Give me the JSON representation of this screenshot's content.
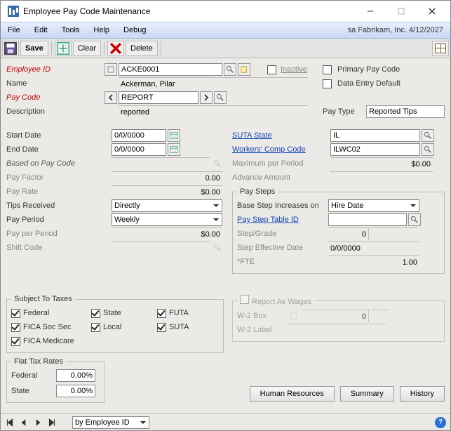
{
  "window": {
    "title": "Employee Pay Code Maintenance"
  },
  "menu": {
    "file": "File",
    "edit": "Edit",
    "tools": "Tools",
    "help": "Help",
    "debug": "Debug",
    "status": "sa  Fabrikam, Inc.  4/12/2027"
  },
  "toolbar": {
    "save": "Save",
    "clear": "Clear",
    "delete": "Delete"
  },
  "header": {
    "employee_id_label": "Employee ID",
    "employee_id": "ACKE0001",
    "name_label": "Name",
    "name": "Ackerman, Pilar",
    "pay_code_label": "Pay Code",
    "pay_code": "REPORT",
    "description_label": "Description",
    "description": "reported",
    "inactive_label": "Inactive",
    "primary_label": "Primary Pay Code",
    "data_entry_default_label": "Data Entry Default",
    "pay_type_label": "Pay Type",
    "pay_type": "Reported Tips"
  },
  "left": {
    "start_date_label": "Start Date",
    "start_date": "0/0/0000",
    "end_date_label": "End Date",
    "end_date": "0/0/0000",
    "based_on_label": "Based on Pay Code",
    "based_on": "",
    "pay_factor_label": "Pay Factor",
    "pay_factor": "0.00",
    "pay_rate_label": "Pay Rate",
    "pay_rate": "$0.00",
    "tips_received_label": "Tips Received",
    "tips_received": "Directly",
    "pay_period_label": "Pay Period",
    "pay_period": "Weekly",
    "pay_per_period_label": "Pay per Period",
    "pay_per_period": "$0.00",
    "shift_code_label": "Shift Code",
    "shift_code": ""
  },
  "right": {
    "suta_state_label": "SUTA State",
    "suta_state": "IL",
    "wc_code_label": "Workers' Comp Code",
    "wc_code": "ILWC02",
    "max_period_label": "Maximum per Period",
    "max_period": "$0.00",
    "advance_label": "Advance Amount",
    "advance": "",
    "pay_steps_legend": "Pay Steps",
    "base_step_label": "Base Step Increases on",
    "base_step": "Hire Date",
    "step_table_label": "Pay Step Table ID",
    "step_table": "",
    "step_grade_label": "Step/Grade",
    "step_grade": "0",
    "step_eff_label": "Step Effective Date",
    "step_eff": "0/0/0000",
    "fte_label": "*FTE",
    "fte": "1.00"
  },
  "taxes": {
    "legend": "Subject To Taxes",
    "federal": "Federal",
    "state": "State",
    "futa": "FUTA",
    "fica_ss": "FICA Soc Sec",
    "local": "Local",
    "suta": "SUTA",
    "fica_med": "FICA Medicare"
  },
  "w2": {
    "legend": "Report As Wages",
    "box_label": "W-2 Box",
    "box": "0",
    "label_label": "W-2 Label",
    "label": ""
  },
  "flat_tax": {
    "legend": "Flat Tax Rates",
    "federal_label": "Federal",
    "federal": "0.00%",
    "state_label": "State",
    "state": "0.00%"
  },
  "buttons": {
    "hr": "Human Resources",
    "summary": "Summary",
    "history": "History"
  },
  "nav": {
    "by": "by Employee ID"
  }
}
